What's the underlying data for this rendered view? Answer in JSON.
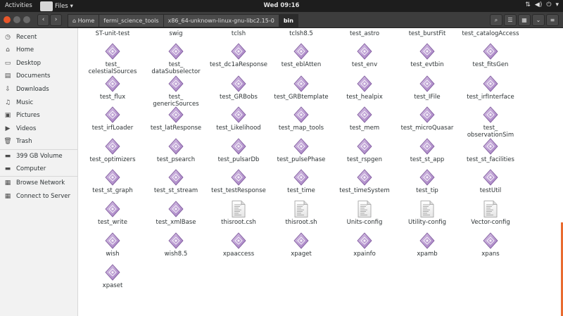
{
  "topbar": {
    "activities": "Activities",
    "app_name": "Files",
    "clock": "Wed 09:16"
  },
  "path": [
    "Home",
    "fermi_science_tools",
    "x86_64-unknown-linux-gnu-libc2.15-0",
    "bin"
  ],
  "sidebar": [
    {
      "label": "Recent",
      "icon": "clock-icon"
    },
    {
      "label": "Home",
      "icon": "home-icon"
    },
    {
      "label": "Desktop",
      "icon": "desktop-icon"
    },
    {
      "label": "Documents",
      "icon": "documents-icon"
    },
    {
      "label": "Downloads",
      "icon": "download-icon"
    },
    {
      "label": "Music",
      "icon": "music-icon"
    },
    {
      "label": "Pictures",
      "icon": "pictures-icon"
    },
    {
      "label": "Videos",
      "icon": "video-icon"
    },
    {
      "label": "Trash",
      "icon": "trash-icon"
    },
    {
      "label": "399 GB Volume",
      "icon": "drive-icon"
    },
    {
      "label": "Computer",
      "icon": "computer-icon"
    },
    {
      "label": "Browse Network",
      "icon": "network-icon"
    },
    {
      "label": "Connect to Server",
      "icon": "server-icon"
    }
  ],
  "top_row": [
    "ST-unit-test",
    "swig",
    "tclsh",
    "tclsh8.5",
    "test_astro",
    "test_burstFit",
    "test_catalogAccess"
  ],
  "files": [
    {
      "name": "test_\ncelestialSources",
      "type": "executable"
    },
    {
      "name": "test_\ndataSubselector",
      "type": "executable"
    },
    {
      "name": "test_dc1aResponse",
      "type": "executable"
    },
    {
      "name": "test_eblAtten",
      "type": "executable"
    },
    {
      "name": "test_env",
      "type": "executable"
    },
    {
      "name": "test_evtbin",
      "type": "executable"
    },
    {
      "name": "test_fitsGen",
      "type": "executable"
    },
    {
      "name": "test_flux",
      "type": "executable"
    },
    {
      "name": "test_\ngenericSources",
      "type": "executable"
    },
    {
      "name": "test_GRBobs",
      "type": "executable"
    },
    {
      "name": "test_GRBtemplate",
      "type": "executable"
    },
    {
      "name": "test_healpix",
      "type": "executable"
    },
    {
      "name": "test_IFile",
      "type": "executable"
    },
    {
      "name": "test_irfInterface",
      "type": "executable"
    },
    {
      "name": "test_irfLoader",
      "type": "executable"
    },
    {
      "name": "test_latResponse",
      "type": "executable"
    },
    {
      "name": "test_Likelihood",
      "type": "executable"
    },
    {
      "name": "test_map_tools",
      "type": "executable"
    },
    {
      "name": "test_mem",
      "type": "executable"
    },
    {
      "name": "test_microQuasar",
      "type": "executable"
    },
    {
      "name": "test_\nobservationSim",
      "type": "executable"
    },
    {
      "name": "test_optimizers",
      "type": "executable"
    },
    {
      "name": "test_psearch",
      "type": "executable"
    },
    {
      "name": "test_pulsarDb",
      "type": "executable"
    },
    {
      "name": "test_pulsePhase",
      "type": "executable"
    },
    {
      "name": "test_rspgen",
      "type": "executable"
    },
    {
      "name": "test_st_app",
      "type": "executable"
    },
    {
      "name": "test_st_facilities",
      "type": "executable"
    },
    {
      "name": "test_st_graph",
      "type": "executable"
    },
    {
      "name": "test_st_stream",
      "type": "executable"
    },
    {
      "name": "test_testResponse",
      "type": "executable"
    },
    {
      "name": "test_time",
      "type": "executable"
    },
    {
      "name": "test_timeSystem",
      "type": "executable"
    },
    {
      "name": "test_tip",
      "type": "executable"
    },
    {
      "name": "testUtil",
      "type": "executable"
    },
    {
      "name": "test_write",
      "type": "executable"
    },
    {
      "name": "test_xmlBase",
      "type": "executable"
    },
    {
      "name": "thisroot.csh",
      "type": "script"
    },
    {
      "name": "thisroot.sh",
      "type": "script"
    },
    {
      "name": "Units-config",
      "type": "script"
    },
    {
      "name": "Utility-config",
      "type": "script"
    },
    {
      "name": "Vector-config",
      "type": "script"
    },
    {
      "name": "wish",
      "type": "executable"
    },
    {
      "name": "wish8.5",
      "type": "executable"
    },
    {
      "name": "xpaaccess",
      "type": "executable"
    },
    {
      "name": "xpaget",
      "type": "executable"
    },
    {
      "name": "xpainfo",
      "type": "executable"
    },
    {
      "name": "xpamb",
      "type": "executable"
    },
    {
      "name": "xpans",
      "type": "executable"
    },
    {
      "name": "xpaset",
      "type": "executable"
    }
  ],
  "colors": {
    "accent": "#e8562a",
    "exec_icon": "#9b6fb3",
    "topbar": "#1d1d1d",
    "headerbar": "#3d3d3d"
  }
}
